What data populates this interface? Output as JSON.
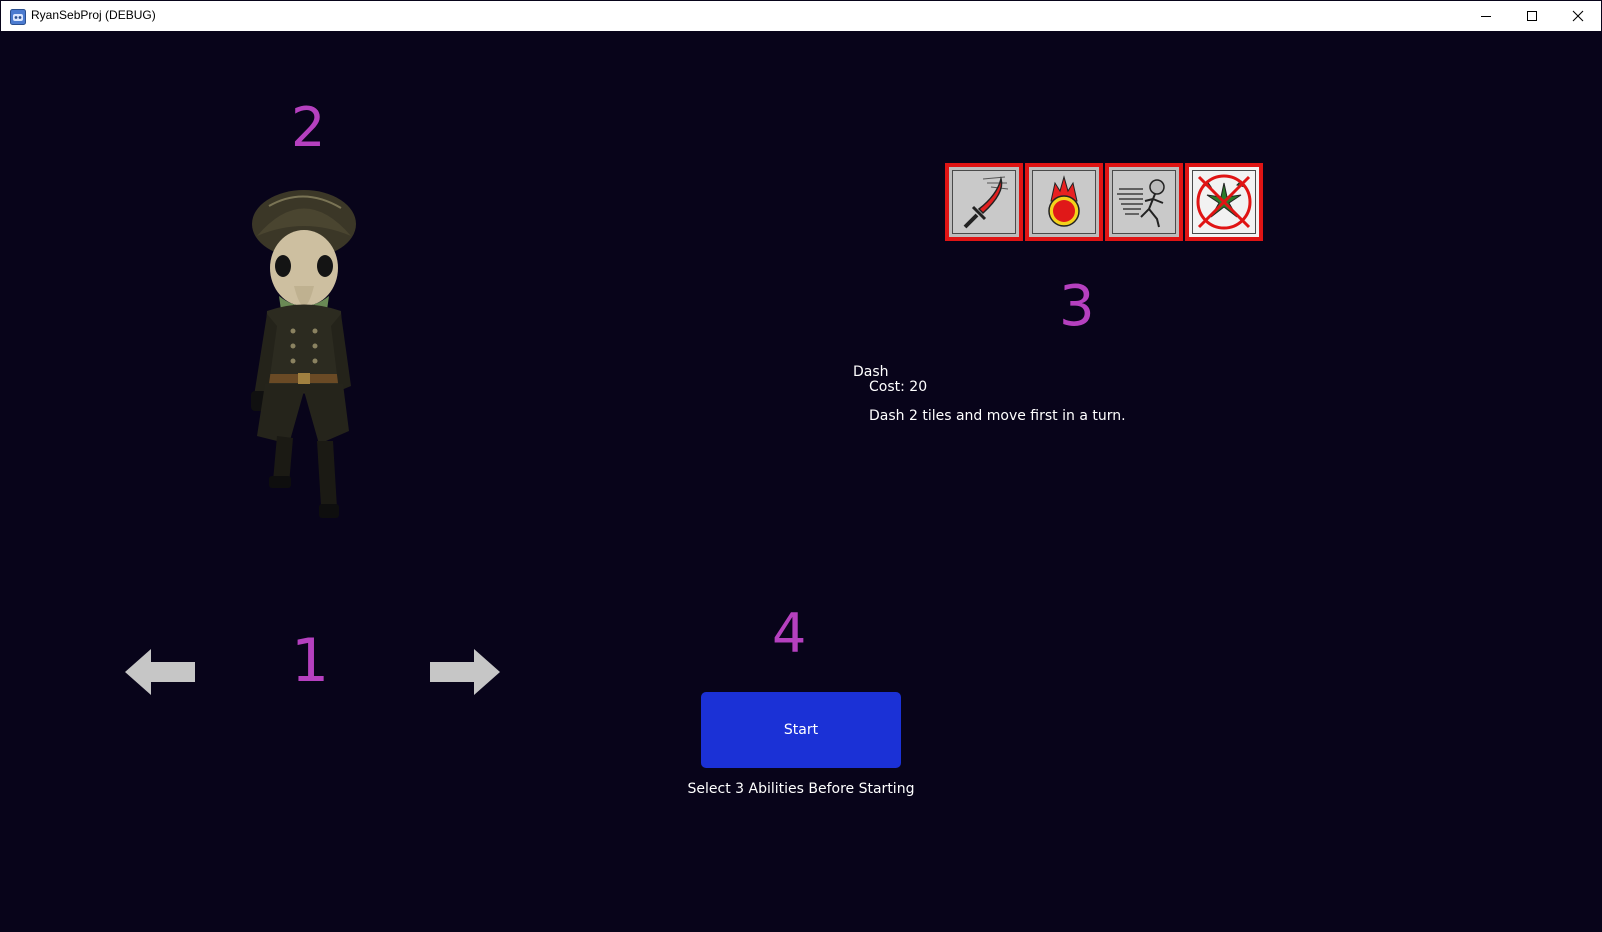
{
  "window": {
    "title": "RyanSebProj (DEBUG)",
    "controls": [
      "minimize-icon",
      "maximize-icon",
      "close-icon"
    ]
  },
  "markers": {
    "one": "1",
    "two": "2",
    "three": "3",
    "four": "4"
  },
  "character": {
    "icon": "character-model"
  },
  "navigation": {
    "prev_icon": "arrow-left-icon",
    "next_icon": "arrow-right-icon"
  },
  "abilities": {
    "slots": [
      {
        "icon": "sword-icon",
        "selected": true
      },
      {
        "icon": "fireball-icon",
        "selected": true
      },
      {
        "icon": "dash-runner-icon",
        "selected": true
      },
      {
        "icon": "poison-icon",
        "selected": false,
        "disabled": true
      }
    ],
    "selected_name": "Dash",
    "selected_cost": "Cost: 20",
    "selected_description": "Dash 2 tiles and move first in a turn."
  },
  "start": {
    "label": "Start",
    "hint": "Select 3 Abilities Before Starting"
  },
  "colors": {
    "background": "#08041a",
    "marker": "#b540bf",
    "slot_border": "#e01414",
    "start_button": "#1b31d6"
  }
}
